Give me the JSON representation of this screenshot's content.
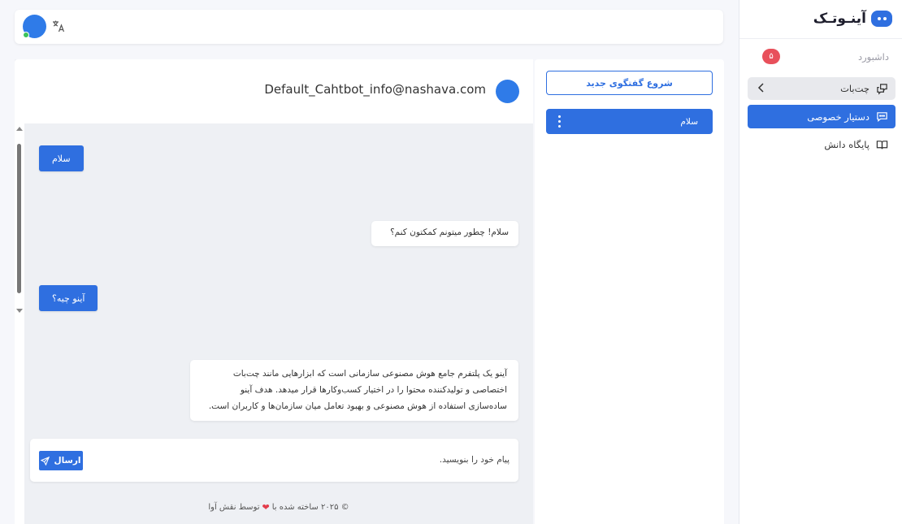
{
  "app": {
    "logo_text": "آینـوتـک"
  },
  "sidebar": {
    "items": [
      {
        "label": "داشبورد",
        "badge": "۵",
        "icon": "none"
      },
      {
        "label": "چت‌بات",
        "icon": "chat-bubbles-icon"
      },
      {
        "label": "دستیار خصوصی",
        "icon": "message-dots-icon",
        "active": true
      },
      {
        "label": "پایگاه دانش",
        "icon": "open-book-icon"
      }
    ]
  },
  "topbar": {
    "icons": [
      "avatar",
      "online-status",
      "translate-icon"
    ]
  },
  "conversations": {
    "new_chat_label": "شروع گفتگوی جدید",
    "items": [
      {
        "title": "سلام"
      }
    ]
  },
  "chat": {
    "header_title": "Default_Cahtbot_info@nashava.com",
    "messages": [
      {
        "role": "user",
        "text": "سلام"
      },
      {
        "role": "bot",
        "text": "سلام! چطور میتونم کمکتون کنم؟"
      },
      {
        "role": "user",
        "text": "آینو چیه؟"
      },
      {
        "role": "bot",
        "lines": [
          "آینو یک پلتفرم جامع هوش مصنوعی سازمانی است که ابزارهایی مانند چت‌بات",
          "اختصاصی و تولیدکننده محتوا را در اختیار کسب‌وکارها قرار میدهد. هدف آینو",
          "ساده‌سازی استفاده از هوش مصنوعی و بهبود تعامل میان سازمان‌ها و کاربران است."
        ]
      }
    ],
    "composer": {
      "placeholder": "پیام خود را بنویسید.",
      "send_label": "ارسال"
    },
    "footer": {
      "prefix": "© ۲۰۲۵ ساخته شده با",
      "suffix": "توسط نقش آوا"
    }
  },
  "colors": {
    "accent": "#2f6fe0",
    "badge": "#e8505b",
    "online": "#3bc25b",
    "heart": "#e33d4b"
  }
}
